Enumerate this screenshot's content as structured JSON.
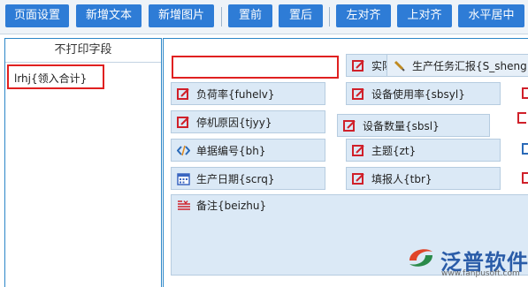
{
  "toolbar": {
    "page_settings": "页面设置",
    "add_text": "新增文本",
    "add_image": "新增图片",
    "bring_front": "置前",
    "send_back": "置后",
    "align_left": "左对齐",
    "align_top": "上对齐",
    "center_horizontal": "水平居中"
  },
  "left_panel": {
    "header": "不打印字段",
    "items": [
      "lrhj{领入合计}"
    ]
  },
  "canvas": {
    "fields": {
      "actual": "实际",
      "report_title": "生产任务汇报{S_sheng",
      "load_rate": "负荷率{fuhelv}",
      "usage_rate": "设备使用率{sbsyl}",
      "stop_reason": "停机原因{tjyy}",
      "equipment_count": "设备数量{sbsl}",
      "doc_number": "单据编号{bh}",
      "subject": "主题{zt}",
      "production_date": "生产日期{scrq}",
      "reporter": "填报人{tbr}",
      "remarks": "备注{beizhu}"
    }
  },
  "watermark": {
    "brand": "泛普软件",
    "url": "www.fanpusoft.com"
  },
  "colors": {
    "toolbar_button": "#2e7cd6",
    "field_bg": "#dbe9f6",
    "highlight": "#e02020",
    "panel_border": "#2c86c8"
  }
}
